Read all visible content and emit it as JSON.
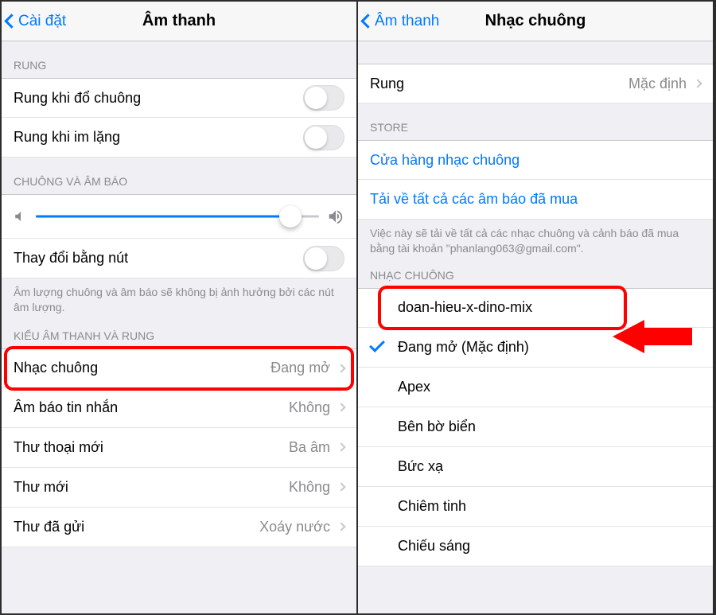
{
  "left": {
    "back": "Cài đặt",
    "title": "Âm thanh",
    "sections": {
      "vibrate": {
        "header": "RUNG"
      },
      "ringer": {
        "header": "CHUÔNG VÀ ÂM BÁO"
      },
      "patterns": {
        "header": "KIỂU ÂM THANH VÀ RUNG"
      }
    },
    "rows": {
      "vibrate_ring": "Rung khi đổ chuông",
      "vibrate_silent": "Rung khi im lặng",
      "change_with_buttons": "Thay đổi bằng nút",
      "footer": "Âm lượng chuông và âm báo sẽ không bị ảnh hưởng bởi các nút âm lượng.",
      "ringtone": {
        "label": "Nhạc chuông",
        "value": "Đang mở"
      },
      "text_tone": {
        "label": "Âm báo tin nhắn",
        "value": "Không"
      },
      "new_vm": {
        "label": "Thư thoại mới",
        "value": "Ba âm"
      },
      "new_mail": {
        "label": "Thư mới",
        "value": "Không"
      },
      "sent_mail": {
        "label": "Thư đã gửi",
        "value": "Xoáy nước"
      }
    }
  },
  "right": {
    "back": "Âm thanh",
    "title": "Nhạc chuông",
    "rows": {
      "vibration": {
        "label": "Rung",
        "value": "Mặc định"
      },
      "store_header": "STORE",
      "store_link": "Cửa hàng nhạc chuông",
      "download_link": "Tải về tất cả các âm báo đã mua",
      "download_footer": "Việc này sẽ tải về tất cả các nhạc chuông và cảnh báo đã mua bằng tài khoản \"phanlang063@gmail.com\".",
      "ringtones_header": "NHẠC CHUÔNG"
    },
    "ringtones": [
      "doan-hieu-x-dino-mix",
      "Đang mở (Mặc định)",
      "Apex",
      "Bên bờ biển",
      "Bức xạ",
      "Chiêm tinh",
      "Chiếu sáng"
    ]
  }
}
